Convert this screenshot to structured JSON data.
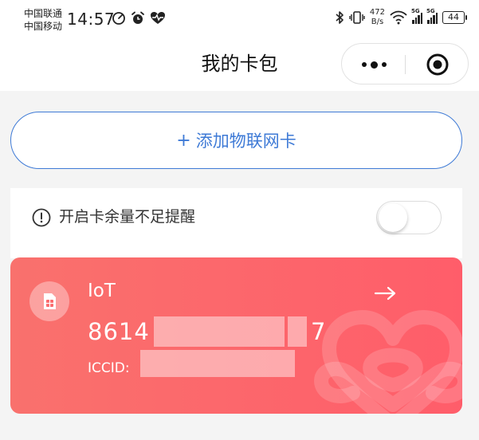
{
  "status_bar": {
    "carrier_1": "中国联通",
    "carrier_2": "中国移动",
    "time": "14:57",
    "net_speed_value": "472",
    "net_speed_unit": "B/s",
    "signal_tag_1": "5G",
    "signal_tag_2": "5G",
    "battery": "44"
  },
  "nav": {
    "title": "我的卡包"
  },
  "add_card": {
    "plus": "+",
    "label": "添加物联网卡"
  },
  "reminder": {
    "label": "开启卡余量不足提醒",
    "enabled": false
  },
  "sim_card": {
    "type": "IoT",
    "number_prefix": "8614",
    "number_suffix": "7",
    "iccid_label": "ICCID:"
  },
  "colors": {
    "accent_blue": "#3e7ad6",
    "card_red_start": "#f9716d",
    "card_red_end": "#ff5d6a"
  }
}
